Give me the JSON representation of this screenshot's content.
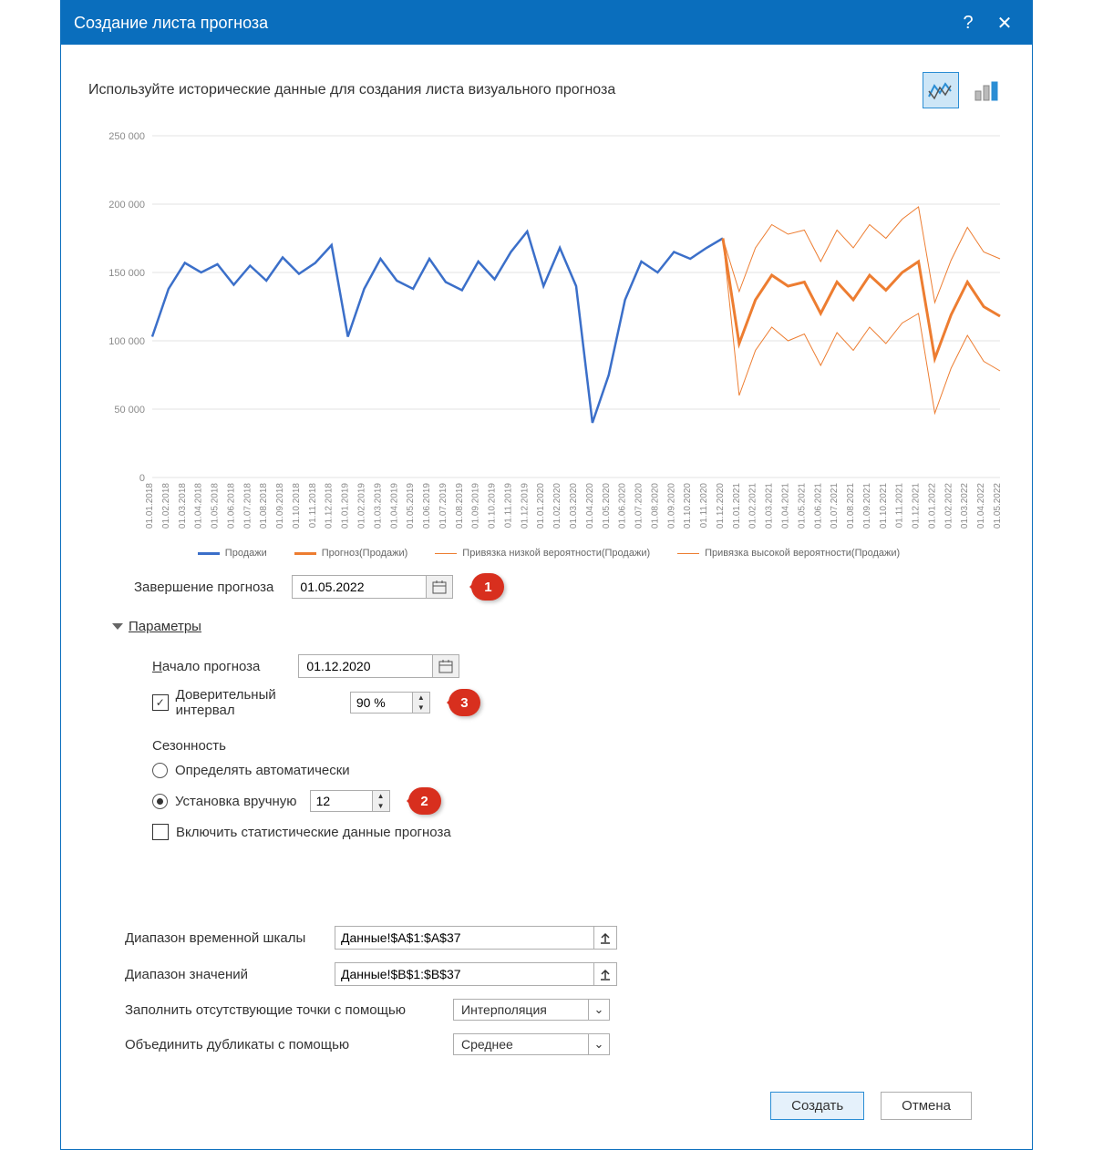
{
  "window": {
    "title": "Создание листа прогноза"
  },
  "subtitle": "Используйте исторические данные для создания листа визуального прогноза",
  "chart_type": {
    "line_selected": true
  },
  "forecast_end": {
    "label": "Завершение прогноза",
    "value": "01.05.2022"
  },
  "options_expander": "Параметры",
  "forecast_start": {
    "label": "Начало прогноза",
    "value": "01.12.2020"
  },
  "confidence": {
    "label": "Доверительный интервал",
    "value": "90 %",
    "checked": true
  },
  "seasonality": {
    "title": "Сезонность",
    "auto_label": "Определять автоматически",
    "manual_label": "Установка вручную",
    "manual_value": "12",
    "manual_selected": true
  },
  "include_stats": {
    "label": "Включить статистические данные прогноза",
    "checked": false
  },
  "timeline_range": {
    "label": "Диапазон временной шкалы",
    "value": "Данные!$A$1:$A$37"
  },
  "values_range": {
    "label": "Диапазон значений",
    "value": "Данные!$B$1:$B$37"
  },
  "fill_missing": {
    "label": "Заполнить отсутствующие точки с помощью",
    "value": "Интерполяция"
  },
  "aggregate": {
    "label": "Объединить дубликаты с помощью",
    "value": "Среднее"
  },
  "buttons": {
    "create": "Создать",
    "cancel": "Отмена"
  },
  "callouts": {
    "1": "1",
    "2": "2",
    "3": "3"
  },
  "legend": {
    "sales": "Продажи",
    "forecast": "Прогноз(Продажи)",
    "lower": "Привязка низкой вероятности(Продажи)",
    "upper": "Привязка высокой вероятности(Продажи)"
  },
  "chart_data": {
    "type": "line",
    "xlabel": "",
    "ylabel": "",
    "ylim": [
      0,
      250000
    ],
    "yticks": [
      0,
      50000,
      100000,
      150000,
      200000,
      250000
    ],
    "ytick_labels": [
      "0",
      "50 000",
      "100 000",
      "150 000",
      "200 000",
      "250 000"
    ],
    "categories": [
      "01.01.2018",
      "01.02.2018",
      "01.03.2018",
      "01.04.2018",
      "01.05.2018",
      "01.06.2018",
      "01.07.2018",
      "01.08.2018",
      "01.09.2018",
      "01.10.2018",
      "01.11.2018",
      "01.12.2018",
      "01.01.2019",
      "01.02.2019",
      "01.03.2019",
      "01.04.2019",
      "01.05.2019",
      "01.06.2019",
      "01.07.2019",
      "01.08.2019",
      "01.09.2019",
      "01.10.2019",
      "01.11.2019",
      "01.12.2019",
      "01.01.2020",
      "01.02.2020",
      "01.03.2020",
      "01.04.2020",
      "01.05.2020",
      "01.06.2020",
      "01.07.2020",
      "01.08.2020",
      "01.09.2020",
      "01.10.2020",
      "01.11.2020",
      "01.12.2020",
      "01.01.2021",
      "01.02.2021",
      "01.03.2021",
      "01.04.2021",
      "01.05.2021",
      "01.06.2021",
      "01.07.2021",
      "01.08.2021",
      "01.09.2021",
      "01.10.2021",
      "01.11.2021",
      "01.12.2021",
      "01.01.2022",
      "01.02.2022",
      "01.03.2022",
      "01.04.2022",
      "01.05.2022"
    ],
    "series": [
      {
        "name": "Продажи",
        "color": "#3b6fc9",
        "width": 2.5,
        "values": [
          103000,
          138000,
          157000,
          150000,
          156000,
          141000,
          155000,
          144000,
          161000,
          149000,
          157000,
          170000,
          103000,
          138000,
          160000,
          144000,
          138000,
          160000,
          143000,
          137000,
          158000,
          145000,
          165000,
          180000,
          140000,
          168000,
          140000,
          40000,
          75000,
          130000,
          158000,
          150000,
          165000,
          160000,
          168000,
          175000,
          null,
          null,
          null,
          null,
          null,
          null,
          null,
          null,
          null,
          null,
          null,
          null,
          null,
          null,
          null,
          null,
          null
        ]
      },
      {
        "name": "Прогноз(Продажи)",
        "color": "#ed7d31",
        "width": 3,
        "values": [
          null,
          null,
          null,
          null,
          null,
          null,
          null,
          null,
          null,
          null,
          null,
          null,
          null,
          null,
          null,
          null,
          null,
          null,
          null,
          null,
          null,
          null,
          null,
          null,
          null,
          null,
          null,
          null,
          null,
          null,
          null,
          null,
          null,
          null,
          null,
          175000,
          98000,
          130000,
          148000,
          140000,
          143000,
          120000,
          143000,
          130000,
          148000,
          137000,
          150000,
          158000,
          87000,
          119000,
          143000,
          125000,
          118000
        ]
      },
      {
        "name": "Привязка низкой вероятности(Продажи)",
        "color": "#ed7d31",
        "width": 1,
        "values": [
          null,
          null,
          null,
          null,
          null,
          null,
          null,
          null,
          null,
          null,
          null,
          null,
          null,
          null,
          null,
          null,
          null,
          null,
          null,
          null,
          null,
          null,
          null,
          null,
          null,
          null,
          null,
          null,
          null,
          null,
          null,
          null,
          null,
          null,
          null,
          175000,
          60000,
          93000,
          110000,
          100000,
          105000,
          82000,
          106000,
          93000,
          110000,
          98000,
          113000,
          120000,
          47000,
          80000,
          104000,
          85000,
          78000
        ]
      },
      {
        "name": "Привязка высокой вероятности(Продажи)",
        "color": "#ed7d31",
        "width": 1,
        "values": [
          null,
          null,
          null,
          null,
          null,
          null,
          null,
          null,
          null,
          null,
          null,
          null,
          null,
          null,
          null,
          null,
          null,
          null,
          null,
          null,
          null,
          null,
          null,
          null,
          null,
          null,
          null,
          null,
          null,
          null,
          null,
          null,
          null,
          null,
          null,
          175000,
          136000,
          168000,
          185000,
          178000,
          181000,
          158000,
          181000,
          168000,
          185000,
          175000,
          189000,
          198000,
          128000,
          159000,
          183000,
          165000,
          160000
        ]
      }
    ]
  }
}
